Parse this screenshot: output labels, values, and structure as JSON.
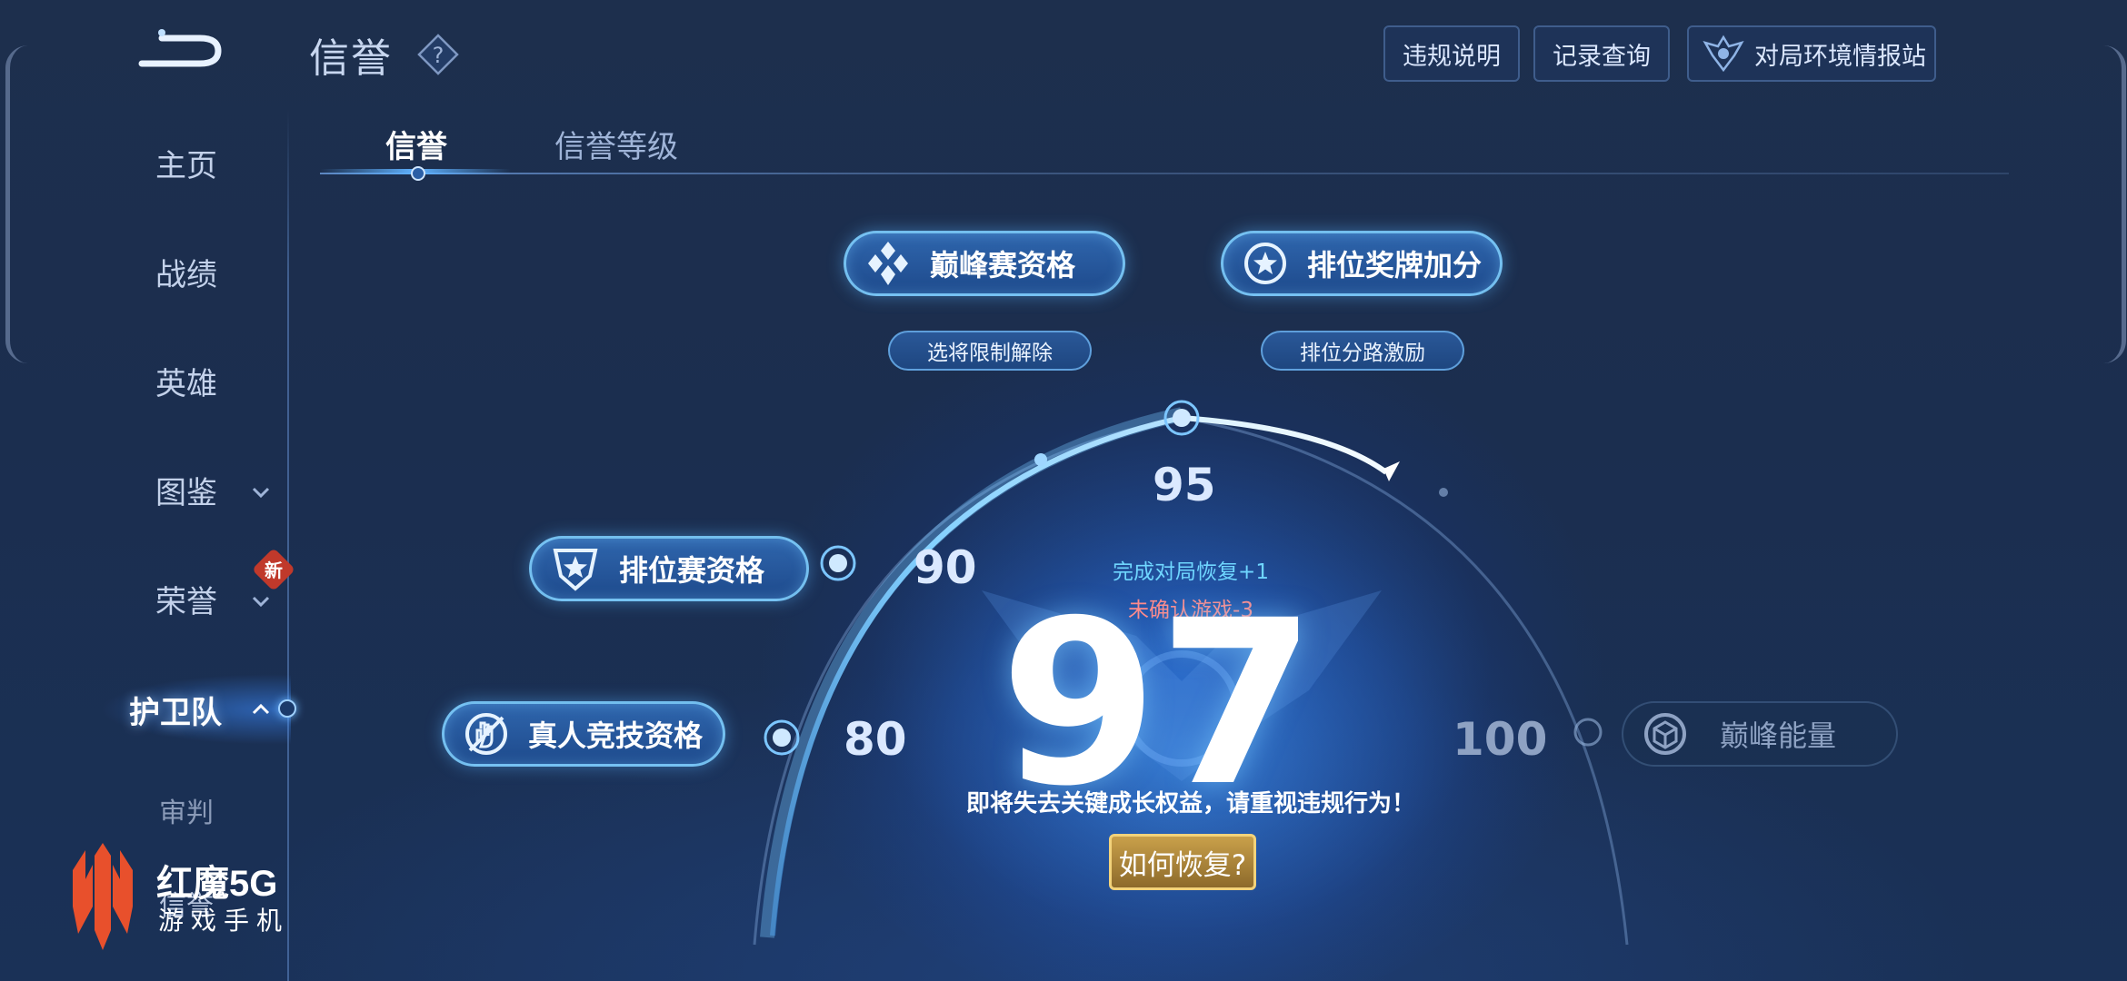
{
  "header": {
    "title": "信誉",
    "buttons": {
      "violation_desc": "违规说明",
      "record_query": "记录查询",
      "env_station": "对局环境情报站"
    }
  },
  "sidebar": {
    "items": [
      {
        "label": "主页"
      },
      {
        "label": "战绩"
      },
      {
        "label": "英雄"
      },
      {
        "label": "图鉴"
      },
      {
        "label": "荣誉",
        "badge": "新"
      },
      {
        "label": "护卫队",
        "active": true
      },
      {
        "label": "审判"
      },
      {
        "label": "信誉"
      }
    ]
  },
  "tabs": [
    {
      "label": "信誉",
      "active": true
    },
    {
      "label": "信誉等级"
    }
  ],
  "benefits": {
    "peak_match": "巅峰赛资格",
    "rank_medal": "排位奖牌加分",
    "pick_unlock": "选将限制解除",
    "rank_lane": "排位分路激励",
    "rank_match": "排位赛资格",
    "human_match": "真人竞技资格",
    "peak_energy": "巅峰能量"
  },
  "scale": {
    "t80": "80",
    "t90": "90",
    "t95": "95",
    "t100": "100"
  },
  "credit": {
    "score": "97",
    "recover_hint": "完成对局恢复+1",
    "penalty_hint": "未确认游戏-3",
    "warning": "即将失去关键成长权益，请重视违规行为！",
    "how_recover": "如何恢复?"
  },
  "logo": {
    "brand": "红魔5G",
    "tagline": "游戏手机"
  },
  "colors": {
    "accent": "#5fb2ff",
    "green_hint": "#6fd6ff",
    "red_hint": "#ff8b8b",
    "gold_button": "#c9a04a",
    "logo_red": "#e8502c"
  }
}
